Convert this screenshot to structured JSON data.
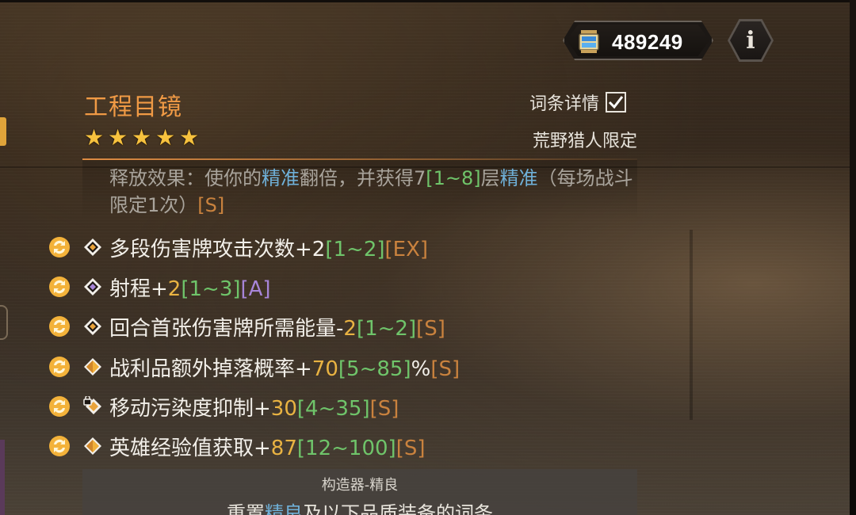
{
  "currency": {
    "value": "489249",
    "icon": "battery-canister-icon"
  },
  "info_button": {
    "label": "i"
  },
  "item": {
    "name": "工程目镜",
    "stars": 5,
    "restriction": "荒野猎人限定",
    "detail_toggle": {
      "label": "词条详情",
      "checked": true
    }
  },
  "effect": {
    "p1": "释放效果：使你的",
    "k1": "精准",
    "p2": "翻倍，并获得7",
    "r1": "[1~8]",
    "p3": "层",
    "k2": "精准",
    "p4": "（每场战斗限定1次）",
    "grade": "[S]"
  },
  "affixes": [
    {
      "gem": "gold-diamond-icon",
      "name": "多段伤害牌攻击次数+",
      "value": "2",
      "range": "[1~2]",
      "suffix": "",
      "grade": "[EX]",
      "value_color": "white",
      "grade_class": "g-ex"
    },
    {
      "gem": "purple-diamond-icon",
      "name": "射程+",
      "value": "2",
      "range": "[1~3]",
      "suffix": "",
      "grade": "[A]",
      "value_color": "yellow",
      "grade_class": "g-a"
    },
    {
      "gem": "gold-diamond-icon",
      "name": "回合首张伤害牌所需能量-",
      "value": "2",
      "range": "[1~2]",
      "suffix": "",
      "grade": "[S]",
      "value_color": "yellow",
      "grade_class": "g-s"
    },
    {
      "gem": "gold-gem-icon",
      "name": "战利品额外掉落概率+",
      "value": "70",
      "range": "[5~85]",
      "suffix": "%",
      "grade": "[S]",
      "value_color": "yellow",
      "grade_class": "g-s"
    },
    {
      "gem": "locked-gem-icon",
      "name": "移动污染度抑制+",
      "value": "30",
      "range": "[4~35]",
      "suffix": "",
      "grade": "[S]",
      "value_color": "yellow",
      "grade_class": "g-s"
    },
    {
      "gem": "gold-gem-icon",
      "name": "英雄经验值获取+",
      "value": "87",
      "range": "[12~100]",
      "suffix": "",
      "grade": "[S]",
      "value_color": "yellow",
      "grade_class": "g-s"
    }
  ],
  "footer": {
    "title": "构造器-精良",
    "desc_p1": "重置",
    "desc_kw": "精良",
    "desc_p2": "及以下品质装备的词条"
  },
  "colors": {
    "title": "#f09a45",
    "keyword_blue": "#6fb0d8",
    "range_green": "#6fc46a",
    "value_yellow": "#e9b342",
    "grade_orange": "#c9823e",
    "grade_purple": "#a785d8"
  }
}
